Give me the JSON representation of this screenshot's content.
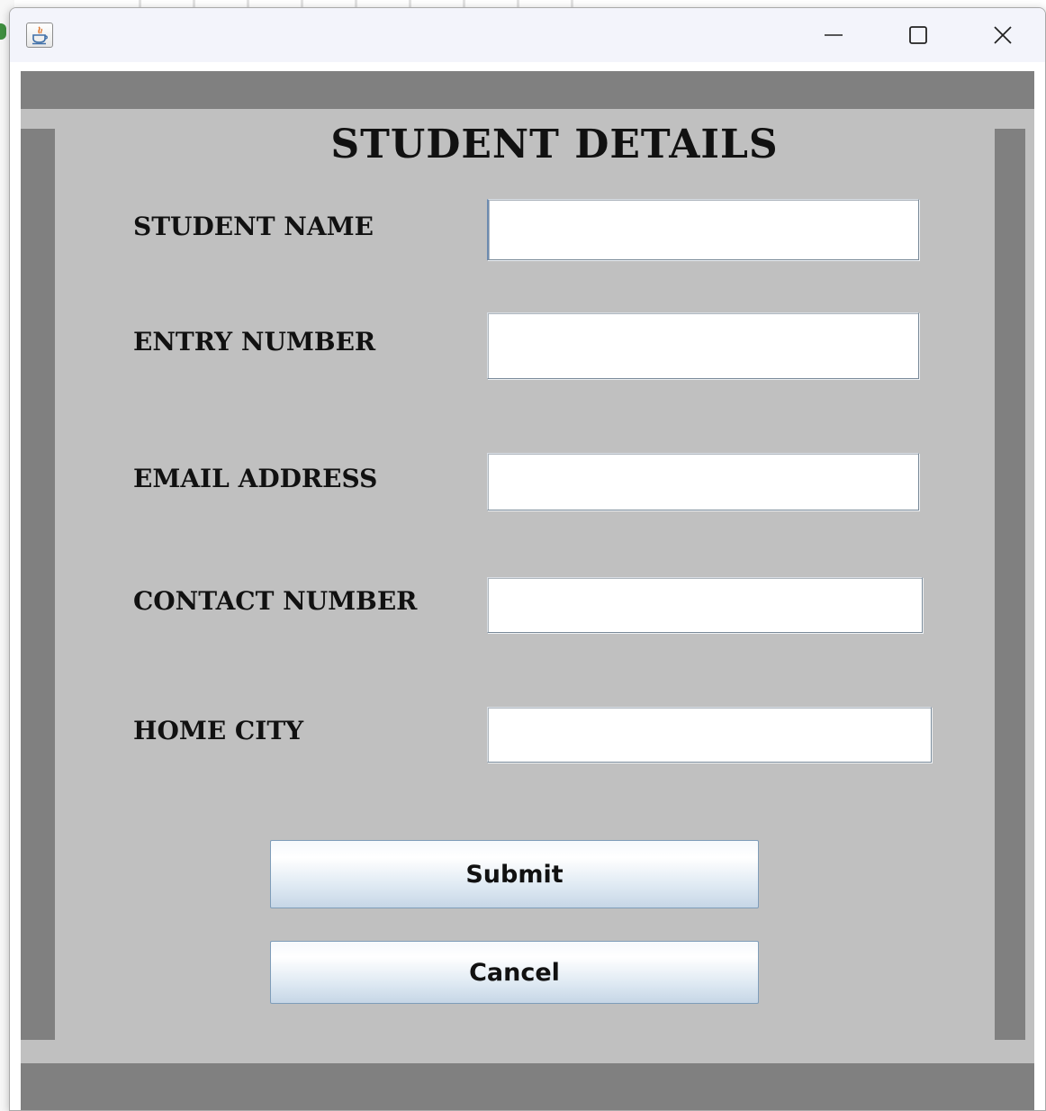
{
  "window": {
    "app_icon": "java-icon",
    "controls": {
      "minimize_icon": "minimize-icon",
      "maximize_icon": "maximize-icon",
      "close_icon": "close-icon"
    }
  },
  "form": {
    "title": "STUDENT DETAILS",
    "fields": [
      {
        "label": "STUDENT NAME",
        "value": "",
        "placeholder": "",
        "focused": true
      },
      {
        "label": "ENTRY NUMBER",
        "value": "",
        "placeholder": ""
      },
      {
        "label": "EMAIL ADDRESS",
        "value": "",
        "placeholder": ""
      },
      {
        "label": "CONTACT NUMBER",
        "value": "",
        "placeholder": ""
      },
      {
        "label": "HOME CITY",
        "value": "",
        "placeholder": ""
      }
    ],
    "submit_label": "Submit",
    "cancel_label": "Cancel"
  },
  "colors": {
    "panel": "#c0c0c0",
    "border_strips": "#808080",
    "titlebar": "#f3f4fb",
    "button_border": "#7f9db9"
  }
}
